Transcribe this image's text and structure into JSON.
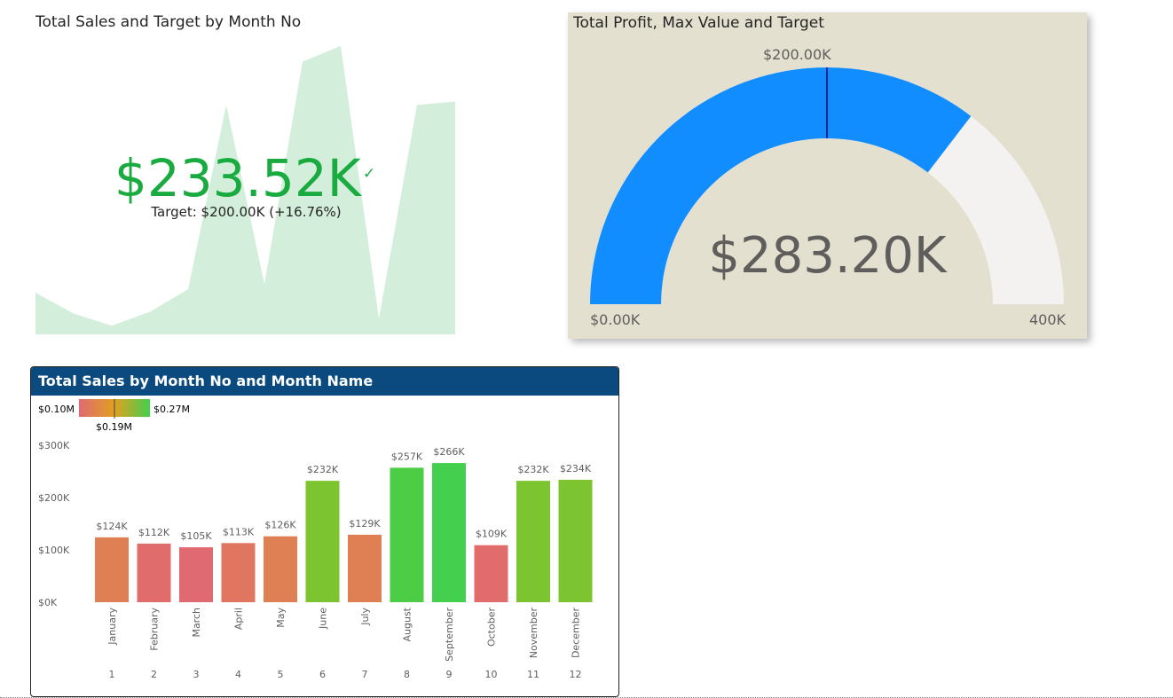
{
  "kpi_card": {
    "title": "Total Sales and Target by Month No",
    "value": "$233.52K",
    "check_icon": "checkmark-icon",
    "target_text": "Target: $200.00K (+16.76%)",
    "value_color": "#1aab40",
    "trend_color": "#d3eedb"
  },
  "gauge_card": {
    "title": "Total Profit, Max Value and Target",
    "value": "$283.20K",
    "target_label": "$200.00K",
    "min_label": "$0.00K",
    "max_label": "400K",
    "fill_color": "#118dff",
    "track_color": "#f3f2f1",
    "background": "#e4e0d0"
  },
  "bar_card": {
    "title": "Total Sales by Month No and Month Name",
    "header_color": "#0a4a7e",
    "legend": {
      "min": "$0.10M",
      "max": "$0.27M",
      "mid": "$0.19M"
    }
  },
  "chart_data": [
    {
      "type": "area",
      "title": "Total Sales and Target by Month No",
      "x": [
        1,
        2,
        3,
        4,
        5,
        6,
        7,
        8,
        9,
        10,
        11,
        12
      ],
      "values": [
        124,
        112,
        105,
        113,
        126,
        232,
        129,
        257,
        266,
        109,
        232,
        234
      ],
      "note_units": "thousands USD"
    },
    {
      "type": "gauge",
      "title": "Total Profit, Max Value and Target",
      "value": 283.2,
      "min": 0,
      "max": 400,
      "target": 200,
      "units": "K USD"
    },
    {
      "type": "bar",
      "title": "Total Sales by Month No and Month Name",
      "categories": [
        "January",
        "February",
        "March",
        "April",
        "May",
        "June",
        "July",
        "August",
        "September",
        "October",
        "November",
        "December"
      ],
      "month_numbers": [
        "1",
        "2",
        "3",
        "4",
        "5",
        "6",
        "7",
        "8",
        "9",
        "10",
        "11",
        "12"
      ],
      "values": [
        124,
        112,
        105,
        113,
        126,
        232,
        129,
        257,
        266,
        109,
        232,
        234
      ],
      "data_labels": [
        "$124K",
        "$112K",
        "$105K",
        "$113K",
        "$126K",
        "$232K",
        "$129K",
        "$257K",
        "$266K",
        "$109K",
        "$232K",
        "$234K"
      ],
      "y_ticks": [
        "$0K",
        "$100K",
        "$200K",
        "$300K"
      ],
      "ylim": [
        0,
        300
      ],
      "colors": [
        "#df8054",
        "#e06c6c",
        "#e06a72",
        "#e07560",
        "#df8054",
        "#7cc530",
        "#df8054",
        "#4dcc46",
        "#45cf4e",
        "#e06c6c",
        "#7cc530",
        "#7cc530"
      ]
    }
  ]
}
